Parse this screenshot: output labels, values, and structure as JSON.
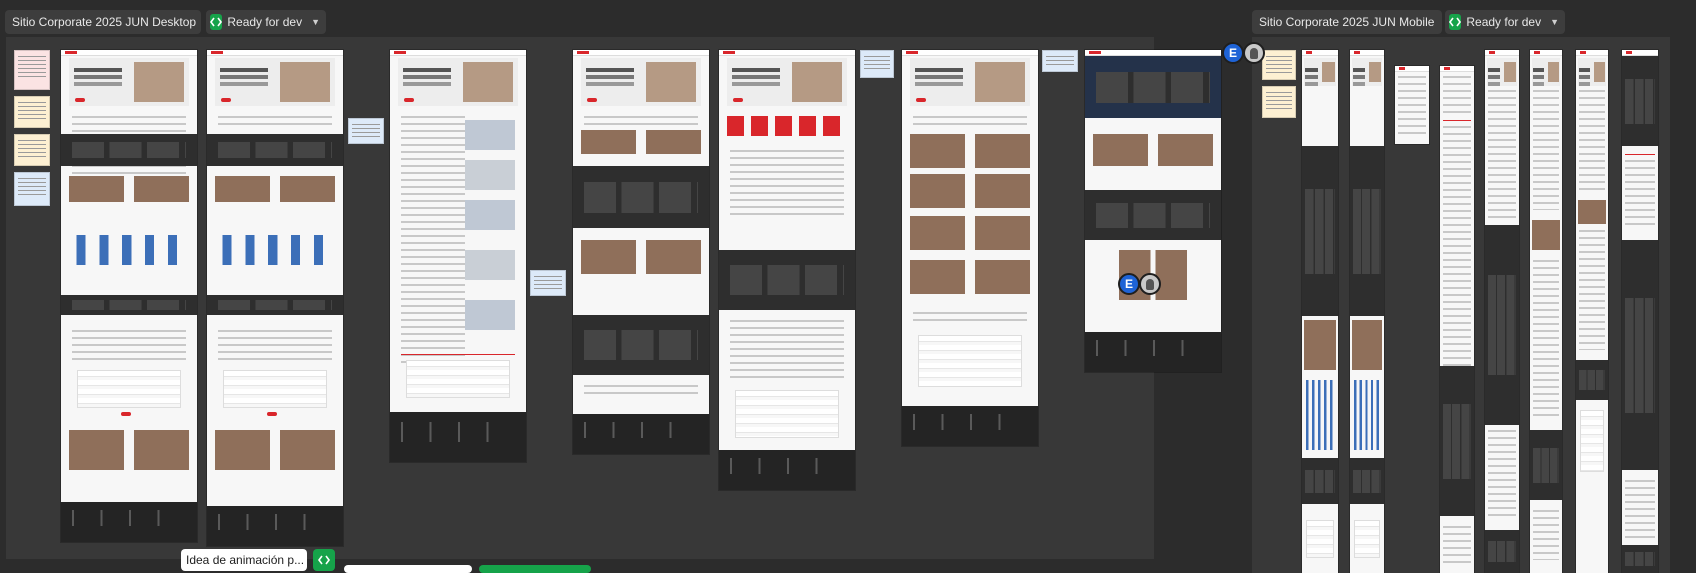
{
  "canvas": {
    "background": "#2c2c2c"
  },
  "sections": {
    "desktop": {
      "title": "Sitio Corporate 2025 JUN Desktop",
      "status_label": "Ready for dev",
      "status_color": "#16a34a",
      "status_icon": "code-icon"
    },
    "mobile": {
      "title": "Sitio Corporate 2025 JUN Mobile",
      "status_label": "Ready for dev",
      "status_color": "#16a34a",
      "status_icon": "code-icon"
    }
  },
  "collaborators": [
    {
      "initial": "E",
      "color": "#1e63d6"
    },
    {
      "initial": "E",
      "color": "#1e63d6"
    }
  ],
  "bottom_section": {
    "title": "Idea de animación p...",
    "status_icon": "code-icon"
  },
  "colors": {
    "brand_red": "#d9262b",
    "frame_bg": "#f7f7f7",
    "dark_band": "#2e2e2e"
  }
}
